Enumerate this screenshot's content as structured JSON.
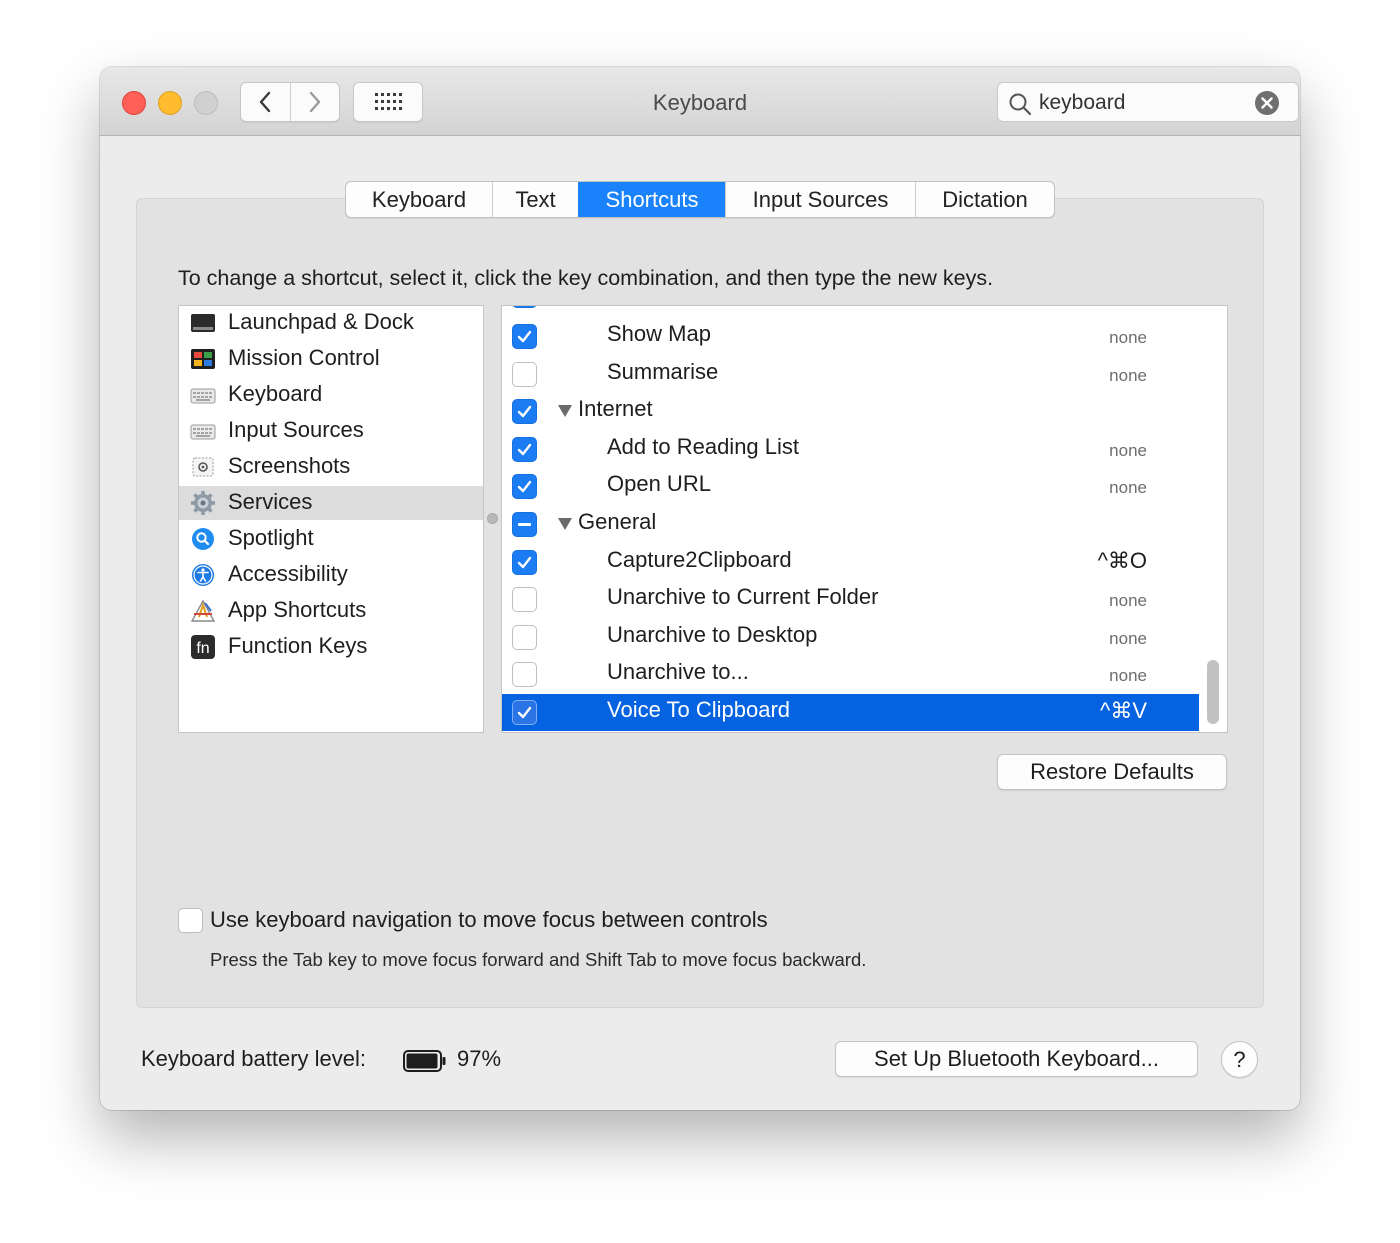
{
  "window": {
    "title": "Keyboard",
    "search_value": "keyboard"
  },
  "tabs": [
    {
      "label": "Keyboard",
      "active": false
    },
    {
      "label": "Text",
      "active": false
    },
    {
      "label": "Shortcuts",
      "active": true
    },
    {
      "label": "Input Sources",
      "active": false
    },
    {
      "label": "Dictation",
      "active": false
    }
  ],
  "instruction": "To change a shortcut, select it, click the key combination, and then type the new keys.",
  "categories": [
    {
      "label": "Launchpad & Dock",
      "icon": "launchpad-icon",
      "selected": false
    },
    {
      "label": "Mission Control",
      "icon": "mission-control-icon",
      "selected": false
    },
    {
      "label": "Keyboard",
      "icon": "keyboard-icon",
      "selected": false
    },
    {
      "label": "Input Sources",
      "icon": "input-sources-icon",
      "selected": false
    },
    {
      "label": "Screenshots",
      "icon": "screenshots-icon",
      "selected": false
    },
    {
      "label": "Services",
      "icon": "gear-icon",
      "selected": true
    },
    {
      "label": "Spotlight",
      "icon": "spotlight-icon",
      "selected": false
    },
    {
      "label": "Accessibility",
      "icon": "accessibility-icon",
      "selected": false
    },
    {
      "label": "App Shortcuts",
      "icon": "app-shortcuts-icon",
      "selected": false
    },
    {
      "label": "Function Keys",
      "icon": "fn-icon",
      "selected": false
    }
  ],
  "shortcuts": [
    {
      "label": "Show Map",
      "key": "none",
      "state": "on",
      "type": "item"
    },
    {
      "label": "Summarise",
      "key": "none",
      "state": "off",
      "type": "item"
    },
    {
      "label": "Internet",
      "key": "",
      "state": "on",
      "type": "group"
    },
    {
      "label": "Add to Reading List",
      "key": "none",
      "state": "on",
      "type": "item"
    },
    {
      "label": "Open URL",
      "key": "none",
      "state": "on",
      "type": "item"
    },
    {
      "label": "General",
      "key": "",
      "state": "mixed",
      "type": "group"
    },
    {
      "label": "Capture2Clipboard",
      "key": "^⌘O",
      "state": "on",
      "type": "item"
    },
    {
      "label": "Unarchive to Current Folder",
      "key": "none",
      "state": "off",
      "type": "item"
    },
    {
      "label": "Unarchive to Desktop",
      "key": "none",
      "state": "off",
      "type": "item"
    },
    {
      "label": "Unarchive to...",
      "key": "none",
      "state": "off",
      "type": "item"
    },
    {
      "label": "Voice To Clipboard",
      "key": "^⌘V",
      "state": "on",
      "type": "item",
      "selected": true
    }
  ],
  "restore_defaults": "Restore Defaults",
  "keyboard_navigation": {
    "label": "Use keyboard navigation to move focus between controls",
    "hint": "Press the Tab key to move focus forward and Shift Tab to move focus backward.",
    "checked": false
  },
  "battery": {
    "label": "Keyboard battery level:",
    "percent_text": "97%",
    "level": 0.97
  },
  "bluetooth_button": "Set Up Bluetooth Keyboard...",
  "help_button": "?",
  "colors": {
    "accent": "#1a82fb",
    "selection": "#0563e1",
    "close": "#fe5f57",
    "minimize": "#febc2e"
  }
}
